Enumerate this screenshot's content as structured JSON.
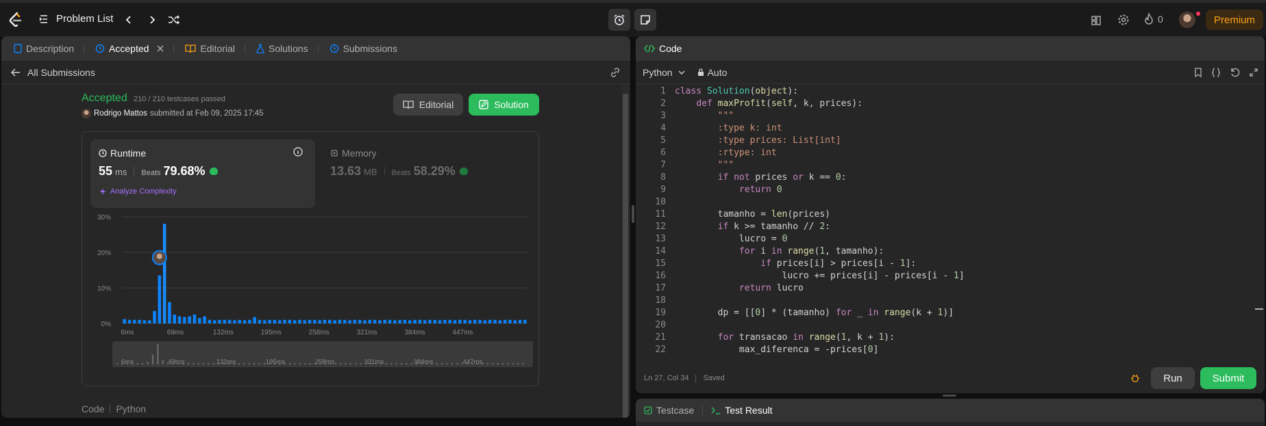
{
  "topbar": {
    "problem_list": "Problem List",
    "streak_count": "0",
    "premium": "Premium"
  },
  "left_tabs": [
    {
      "label": "Description"
    },
    {
      "label": "Accepted"
    },
    {
      "label": "Editorial"
    },
    {
      "label": "Solutions"
    },
    {
      "label": "Submissions"
    }
  ],
  "submission": {
    "back_label": "All Submissions",
    "status": "Accepted",
    "testcases": "210 / 210 testcases passed",
    "user": "Rodrigo Mattos",
    "submitted_text": "submitted at Feb 09, 2025 17:45",
    "editorial_btn": "Editorial",
    "solution_btn": "Solution",
    "runtime_title": "Runtime",
    "runtime_value": "55",
    "runtime_unit": "ms",
    "beats_label": "Beats",
    "runtime_beats": "79.68%",
    "analyze": "Analyze Complexity",
    "memory_title": "Memory",
    "memory_value": "13.63",
    "memory_unit": "MB",
    "memory_beats": "58.29%",
    "code_label": "Code",
    "lang_label": "Python"
  },
  "chart_data": {
    "type": "bar",
    "ylabels": [
      "30%",
      "20%",
      "10%",
      "0%"
    ],
    "xlabels": [
      "6ms",
      "69ms",
      "132ms",
      "195ms",
      "258ms",
      "321ms",
      "384ms",
      "447ms"
    ],
    "ylim": [
      0,
      30
    ],
    "values": [
      1.2,
      1.0,
      1.0,
      1.0,
      0.9,
      0.9,
      3.5,
      13.5,
      28,
      6,
      2.5,
      2.0,
      1.8,
      2.0,
      2.5,
      1.5,
      2.0,
      1.0,
      0.9,
      1.0,
      1.0,
      1.0,
      0.9,
      1.0,
      0.9,
      1.0,
      1.8,
      1.0,
      0.9,
      1.0,
      1.0,
      0.9,
      1.0,
      1.0,
      0.9,
      1.0,
      0.9,
      1.0,
      1.0,
      0.9,
      1.0,
      1.0,
      0.9,
      1.0,
      1.0,
      0.9,
      1.0,
      1.0,
      0.9,
      1.0,
      1.0,
      0.9,
      1.0,
      1.0,
      0.9,
      1.0,
      1.0,
      0.9,
      1.0,
      1.0,
      0.9,
      1.0,
      1.0,
      0.9,
      1.0,
      1.0,
      0.9,
      1.0,
      1.0,
      0.9,
      1.0,
      1.0,
      0.9,
      1.0,
      1.0,
      0.9,
      1.0,
      1.0,
      0.9,
      1.0,
      1.0
    ],
    "highlight_index": 8,
    "user_marker_value": 18.5,
    "mini_labels": [
      "6ms",
      "69ms",
      "132ms",
      "195ms",
      "258ms",
      "321ms",
      "384ms",
      "447ms"
    ],
    "bar_color": "#0a84ff"
  },
  "code_panel": {
    "title": "Code",
    "language": "Python",
    "mode": "Auto",
    "status_pos": "Ln 27, Col 34",
    "status_saved": "Saved",
    "run": "Run",
    "submit": "Submit",
    "testcase": "Testcase",
    "test_result": "Test Result",
    "lines": [
      "class Solution(object):",
      "    def maxProfit(self, k, prices):",
      "        \"\"\"",
      "        :type k: int",
      "        :type prices: List[int]",
      "        :rtype: int",
      "        \"\"\"",
      "        if not prices or k == 0:",
      "            return 0",
      "",
      "        tamanho = len(prices)",
      "        if k >= tamanho // 2:",
      "            lucro = 0",
      "            for i in range(1, tamanho):",
      "                if prices[i] > prices[i - 1]:",
      "                    lucro += prices[i] - prices[i - 1]",
      "            return lucro",
      "",
      "        dp = [[0] * (tamanho) for _ in range(k + 1)]",
      "",
      "        for transacao in range(1, k + 1):",
      "            max_diferenca = -prices[0]"
    ]
  },
  "colors": {
    "accent_green": "#2cbb5d",
    "premium": "#ffa116",
    "bar": "#0a84ff"
  }
}
